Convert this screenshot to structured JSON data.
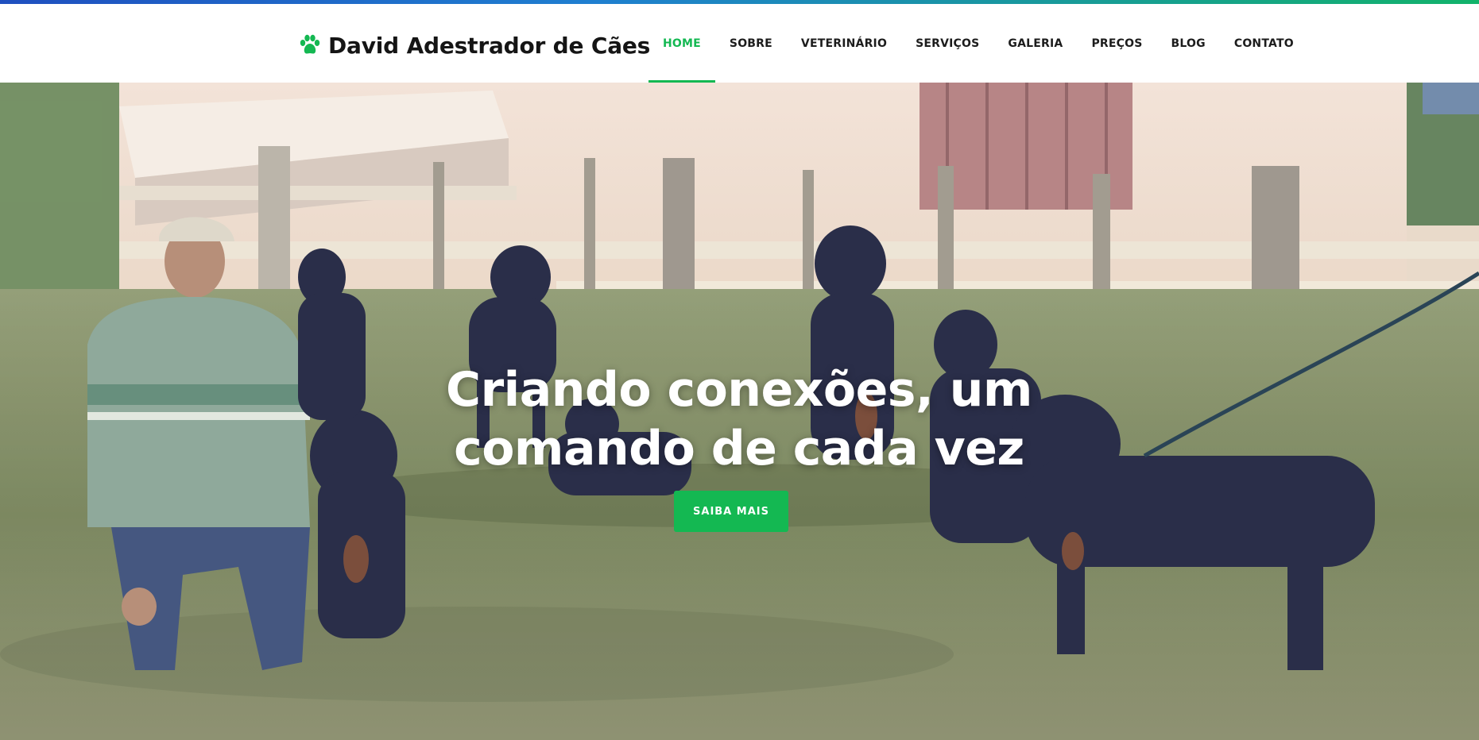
{
  "brand": {
    "title": "David Adestrador de Cães",
    "icon": "paw-icon",
    "icon_color": "#14b852"
  },
  "nav": {
    "active_index": 0,
    "items": [
      {
        "label": "HOME"
      },
      {
        "label": "SOBRE"
      },
      {
        "label": "VETERINÁRIO"
      },
      {
        "label": "SERVIÇOS"
      },
      {
        "label": "GALERIA"
      },
      {
        "label": "PREÇOS"
      },
      {
        "label": "BLOG"
      },
      {
        "label": "CONTATO"
      }
    ]
  },
  "hero": {
    "title_line1": "Criando conexões, um",
    "title_line2": "comando de cada vez",
    "button_label": "SAIBA MAIS",
    "background_description": "photo-man-with-rottweilers-in-field"
  },
  "colors": {
    "accent": "#14b852",
    "text_dark": "#1c1c1c",
    "header_bg": "#ffffff"
  }
}
